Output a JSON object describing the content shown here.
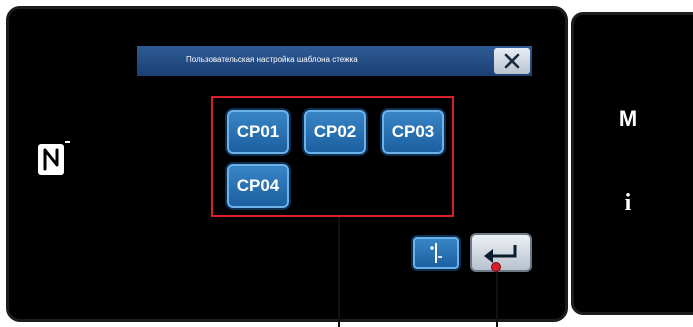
{
  "dialog": {
    "title": "Пользовательская настройка шаблона стежка",
    "close_icon": "close-x-icon"
  },
  "patterns": [
    {
      "label": "CP01"
    },
    {
      "label": "CP02"
    },
    {
      "label": "CP03"
    },
    {
      "label": "CP04"
    }
  ],
  "toolbar": {
    "adjust_icon": "adjust-icon",
    "enter_icon": "enter-return-icon"
  },
  "side_menu": {
    "mode_label": "M",
    "info_label": "i"
  },
  "nfc": {
    "icon": "nfc-icon"
  },
  "colors": {
    "screen_bg": "#000000",
    "title_bar": "#2a538b",
    "button_blue": "#2a74b8",
    "highlight_red": "#d81f2a"
  }
}
